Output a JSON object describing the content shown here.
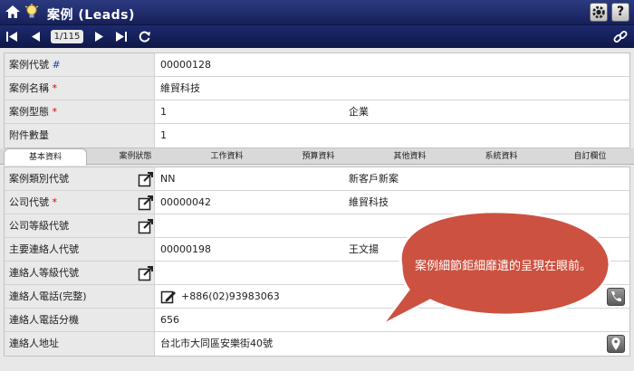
{
  "header": {
    "title": "案例 (Leads)",
    "help_label": "?"
  },
  "nav": {
    "pager": "1/115"
  },
  "summary": [
    {
      "label": "案例代號",
      "marker": "#",
      "value": "00000128",
      "value2": ""
    },
    {
      "label": "案例名稱",
      "marker": "*",
      "value": "維貿科技",
      "value2": ""
    },
    {
      "label": "案例型態",
      "marker": "*",
      "value": "1",
      "value2": "企業"
    },
    {
      "label": "附件數量",
      "marker": "",
      "value": "1",
      "value2": ""
    }
  ],
  "tabs": [
    "基本資料",
    "案例狀態",
    "工作資料",
    "預算資料",
    "其他資料",
    "系統資料",
    "自訂欄位"
  ],
  "details": [
    {
      "label": "案例類別代號",
      "marker": "",
      "value": "NN",
      "value2": "新客戶新案"
    },
    {
      "label": "公司代號",
      "marker": "*",
      "value": "00000042",
      "value2": "維貿科技"
    },
    {
      "label": "公司等級代號",
      "marker": "",
      "value": "",
      "value2": ""
    },
    {
      "label": "主要連絡人代號",
      "marker": "",
      "value": "00000198",
      "value2": "王文揚"
    },
    {
      "label": "連絡人等級代號",
      "marker": "",
      "value": "",
      "value2": ""
    },
    {
      "label": "連絡人電話(完整)",
      "marker": "",
      "value": "+886(02)93983063",
      "value2": ""
    },
    {
      "label": "連絡人電話分機",
      "marker": "",
      "value": "656",
      "value2": ""
    },
    {
      "label": "連絡人地址",
      "marker": "",
      "value": "台北市大同區安樂街40號",
      "value2": ""
    }
  ],
  "callout": {
    "text": "案例細節鉅細靡遺的呈現在眼前。"
  },
  "colors": {
    "title_bar": "#1f2c6e",
    "label_bg": "#e9e9e9",
    "bubble": "#cc5140",
    "required": "#cc0000"
  }
}
